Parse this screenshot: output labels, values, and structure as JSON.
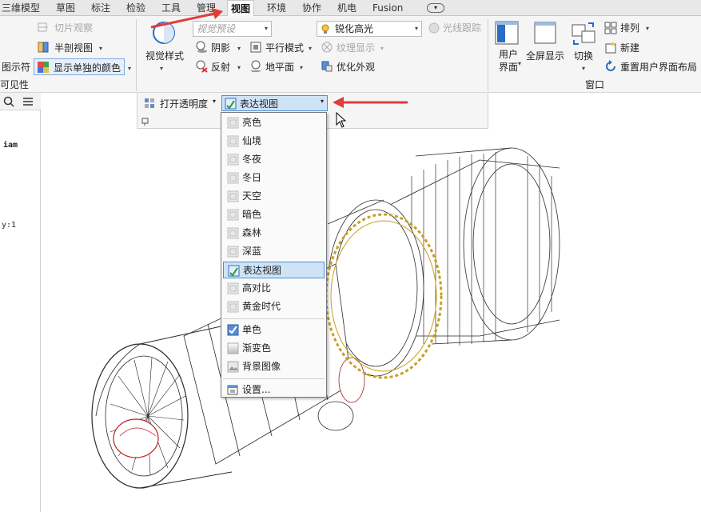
{
  "tabs": [
    {
      "label": "三维模型"
    },
    {
      "label": "草图"
    },
    {
      "label": "标注"
    },
    {
      "label": "检验"
    },
    {
      "label": "工具"
    },
    {
      "label": "管理"
    },
    {
      "label": "视图",
      "active": true
    },
    {
      "label": "环境"
    },
    {
      "label": "协作"
    },
    {
      "label": "机电"
    },
    {
      "label": "Fusion"
    }
  ],
  "ribbon": {
    "left": {
      "slice_view": "切片观察",
      "half_section": "半剖视图",
      "show_part_color_prefix": "图示符",
      "show_part_color": "显示单独的颜色",
      "visibility_label": "可见性"
    },
    "appearance": {
      "visual_style": "视觉样式",
      "visual_preset": "视觉预设",
      "shadow": "阴影",
      "reflection": "反射",
      "parallel_mode": "平行模式",
      "ground_plane": "地平面",
      "sharpen_highlight": "锐化高光",
      "texture_display": "纹理显示",
      "optimize_appearance": "优化外观",
      "ray_tracing": "光线跟踪",
      "transparency": "打开透明度",
      "current_env": "表达视图"
    },
    "window": {
      "user_interface_1": "用户",
      "user_interface_2": "界面",
      "full_screen": "全屏显示",
      "switch": "切换",
      "arrange": "排列",
      "new": "新建",
      "reset_layout": "重置用户界面布局",
      "group_label": "窗口"
    }
  },
  "browser": {
    "line1": "iam",
    "line2": "y:1"
  },
  "dropdown": {
    "items": [
      {
        "label": "亮色",
        "type": "env"
      },
      {
        "label": "仙境",
        "type": "env"
      },
      {
        "label": "冬夜",
        "type": "env"
      },
      {
        "label": "冬日",
        "type": "env"
      },
      {
        "label": "天空",
        "type": "env"
      },
      {
        "label": "暗色",
        "type": "env"
      },
      {
        "label": "森林",
        "type": "env"
      },
      {
        "label": "深蓝",
        "type": "env"
      },
      {
        "label": "表达视图",
        "type": "env",
        "selected": true
      },
      {
        "label": "高对比",
        "type": "env"
      },
      {
        "label": "黄金时代",
        "type": "env"
      }
    ],
    "bg_items": [
      {
        "label": "单色",
        "icon": "checked-color-icon"
      },
      {
        "label": "渐变色",
        "icon": "gradient-icon"
      },
      {
        "label": "背景图像",
        "icon": "image-icon"
      }
    ],
    "settings": "设置..."
  },
  "colors": {
    "accent": "#2b6cc4",
    "selection": "#cfe3f7",
    "arrow": "#e03c3c",
    "model_line": "#2a2a2a",
    "highlight_ring": "#c8a020"
  }
}
